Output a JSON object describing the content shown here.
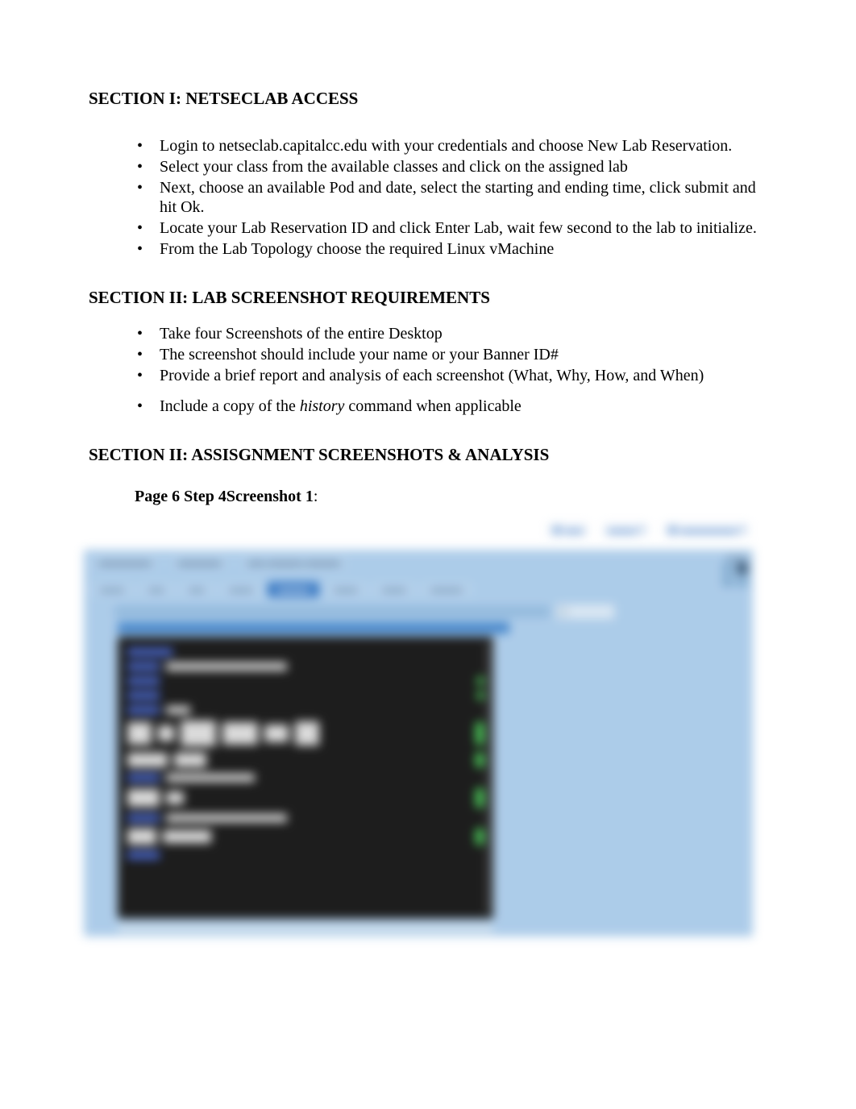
{
  "sections": {
    "s1": {
      "heading": "SECTION I: NETSECLAB ACCESS",
      "items": [
        "Login to netseclab.capitalcc.edu with your credentials and choose New Lab Reservation.",
        "Select your class from the available classes and click on the assigned lab",
        "Next, choose an available Pod and date, select the starting and ending time, click submit and hit Ok.",
        "Locate your Lab Reservation ID and click Enter Lab, wait few second to the lab to initialize.",
        "From the Lab Topology choose the required Linux vMachine"
      ]
    },
    "s2": {
      "heading": "SECTION II: LAB SCREENSHOT REQUIREMENTS",
      "items": [
        "Take four Screenshots of the entire Desktop",
        "The screenshot should include your name or your Banner ID#",
        "Provide a brief report and analysis of each screenshot (What, Why, How, and When)"
      ],
      "item_history_prefix": "Include a copy of the ",
      "item_history_italic": "history",
      "item_history_suffix": " command when applicable"
    },
    "s3": {
      "heading": "SECTION II: ASSISGNMENT SCREENSHOTS & ANALYSIS",
      "caption_bold": "Page 6 Step 4Screenshot 1",
      "caption_colon": ":"
    }
  }
}
